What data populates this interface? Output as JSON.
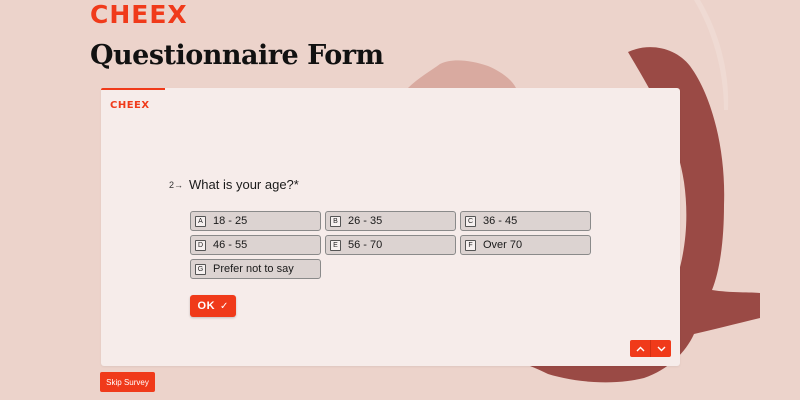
{
  "brand": {
    "logo_text": "CHEEX",
    "card_logo_text": "CHEEX"
  },
  "page": {
    "title": "Questionnaire Form"
  },
  "question": {
    "number": "2",
    "arrow": "→",
    "text": "What is your age?*"
  },
  "options": [
    {
      "key": "A",
      "label": "18 - 25"
    },
    {
      "key": "B",
      "label": "26 - 35"
    },
    {
      "key": "C",
      "label": "36 - 45"
    },
    {
      "key": "D",
      "label": "46 - 55"
    },
    {
      "key": "E",
      "label": "56 - 70"
    },
    {
      "key": "F",
      "label": "Over 70"
    },
    {
      "key": "G",
      "label": "Prefer not to say"
    }
  ],
  "ok_button": {
    "label": "OK",
    "icon": "check-icon"
  },
  "navigation": {
    "up_icon": "chevron-up-icon",
    "down_icon": "chevron-down-icon"
  },
  "skip_button": {
    "label": "Skip Survey"
  },
  "colors": {
    "accent": "#f03a1a",
    "background": "#ecd3cb",
    "card": "#f6ecea",
    "option_fill": "#dcd3d1",
    "decor_dark": "#9a4a45",
    "decor_light": "#d9aaa0"
  }
}
